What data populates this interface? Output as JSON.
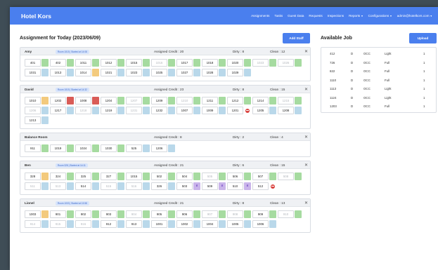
{
  "navbar": {
    "brand": "Hotel Kors",
    "links": [
      "Assignments",
      "Tasks",
      "Guest Data",
      "Requests",
      "Inspections"
    ],
    "reports": "Reports",
    "configurations": "Configurations",
    "user": "admin@hotelkors.com"
  },
  "assignment": {
    "title": "Assignment for Today (2023/06/09)",
    "add_staff_label": "Add Staff",
    "staff": [
      {
        "name": "Amy",
        "badge": "Room 1015 | Started at 14:08",
        "credit": "Assigned Credit : 20",
        "dirty": "Dirty : 8",
        "clean": "Clean : 12",
        "rooms": [
          [
            "401",
            "green",
            ""
          ],
          [
            "402",
            "green",
            ""
          ],
          [
            "1011",
            "green",
            ""
          ],
          [
            "1012",
            "green",
            ""
          ],
          [
            "1015",
            "green",
            ""
          ],
          [
            "1016",
            "green",
            "m"
          ],
          [
            "1017",
            "green",
            ""
          ],
          [
            "1018",
            "green",
            ""
          ],
          [
            "1020",
            "green",
            ""
          ],
          [
            "1023",
            "green",
            "m"
          ],
          [
            "1026",
            "green",
            "m"
          ],
          [
            "1031",
            "blue",
            ""
          ],
          [
            "1013",
            "blue",
            ""
          ],
          [
            "1014",
            "orange",
            ""
          ],
          [
            "1021",
            "blue",
            ""
          ],
          [
            "1023",
            "blue",
            ""
          ],
          [
            "1025",
            "blue",
            ""
          ],
          [
            "1027",
            "blue",
            ""
          ],
          [
            "1028",
            "blue",
            ""
          ],
          [
            "1029",
            "blue",
            ""
          ]
        ]
      },
      {
        "name": "David",
        "badge": "Room 1015 | Started at 14:32",
        "credit": "Assigned Credit : 23",
        "dirty": "Dirty : 8",
        "clean": "Clean : 15",
        "rooms": [
          [
            "1010",
            "orange",
            ""
          ],
          [
            "1202",
            "red",
            ""
          ],
          [
            "1008",
            "red",
            ""
          ],
          [
            "1204",
            "green",
            ""
          ],
          [
            "1207",
            "green",
            "m"
          ],
          [
            "1209",
            "green",
            ""
          ],
          [
            "1210",
            "green",
            "m"
          ],
          [
            "1211",
            "green",
            ""
          ],
          [
            "1212",
            "green",
            ""
          ],
          [
            "1214",
            "green",
            ""
          ],
          [
            "1215",
            "green",
            "m"
          ],
          [
            "1206",
            "blue",
            "m"
          ],
          [
            "1217",
            "blue",
            ""
          ],
          [
            "1218",
            "blue",
            "m"
          ],
          [
            "1219",
            "blue",
            ""
          ],
          [
            "1231",
            "blue",
            "m"
          ],
          [
            "1232",
            "blue",
            ""
          ],
          [
            "1007",
            "blue",
            ""
          ],
          [
            "1009",
            "blue",
            ""
          ],
          [
            "1201",
            "stop",
            ""
          ],
          [
            "1205",
            "blue",
            ""
          ],
          [
            "1208",
            "blue",
            ""
          ],
          [
            "1213",
            "blue",
            ""
          ]
        ]
      },
      {
        "name": "Balance Room",
        "badge": "",
        "credit": "Assigned Credit : 8",
        "dirty": "Dirty : 2",
        "clean": "Clean : 4",
        "rooms": [
          [
            "911",
            "green",
            ""
          ],
          [
            "1019",
            "green",
            ""
          ],
          [
            "1024",
            "green",
            ""
          ],
          [
            "1030",
            "green",
            ""
          ],
          [
            "525",
            "blue",
            ""
          ],
          [
            "1206",
            "blue",
            ""
          ]
        ]
      },
      {
        "name": "Ben",
        "badge": "Room 328 | Started at 14:11",
        "credit": "Assigned Credit : 21",
        "dirty": "Dirty : 6",
        "clean": "Clean : 15",
        "rooms": [
          [
            "328",
            "orange",
            ""
          ],
          [
            "324",
            "green",
            ""
          ],
          [
            "325",
            "green",
            ""
          ],
          [
            "327",
            "green",
            ""
          ],
          [
            "1015",
            "green",
            ""
          ],
          [
            "502",
            "green",
            ""
          ],
          [
            "504",
            "green",
            ""
          ],
          [
            "505",
            "green",
            "m"
          ],
          [
            "506",
            "green",
            ""
          ],
          [
            "507",
            "green",
            ""
          ],
          [
            "508",
            "green",
            "m"
          ],
          [
            "511",
            "blue",
            "m"
          ],
          [
            "513",
            "blue",
            "m"
          ],
          [
            "514",
            "blue",
            ""
          ],
          [
            "515",
            "blue",
            "m"
          ],
          [
            "516",
            "blue",
            "m"
          ],
          [
            "326",
            "blue",
            ""
          ],
          [
            "503",
            "purple",
            ""
          ],
          [
            "509",
            "purple",
            ""
          ],
          [
            "510",
            "purple",
            ""
          ],
          [
            "512",
            "stop",
            ""
          ]
        ]
      },
      {
        "name": "Lionel",
        "badge": "Room 1003 | Started at 13:58",
        "credit": "Assigned Credit : 21",
        "dirty": "Dirty : 8",
        "clean": "Clean : 13",
        "rooms": [
          [
            "1003",
            "orange",
            ""
          ],
          [
            "901",
            "green",
            ""
          ],
          [
            "902",
            "green",
            ""
          ],
          [
            "903",
            "green",
            ""
          ],
          [
            "904",
            "green",
            "m"
          ],
          [
            "905",
            "green",
            ""
          ],
          [
            "906",
            "green",
            ""
          ],
          [
            "907",
            "green",
            "m"
          ],
          [
            "908",
            "green",
            "m"
          ],
          [
            "909",
            "green",
            ""
          ],
          [
            "910",
            "green",
            "m"
          ],
          [
            "914",
            "blue",
            "m"
          ],
          [
            "915",
            "blue",
            "m"
          ],
          [
            "916",
            "blue",
            "m"
          ],
          [
            "912",
            "blue",
            ""
          ],
          [
            "913",
            "blue",
            ""
          ],
          [
            "1001",
            "blue",
            ""
          ],
          [
            "1002",
            "blue",
            ""
          ],
          [
            "1004",
            "blue",
            ""
          ],
          [
            "1005",
            "blue",
            ""
          ],
          [
            "1006",
            "blue",
            ""
          ]
        ]
      }
    ]
  },
  "jobs": {
    "title": "Available Job",
    "upload_label": "Upload",
    "rows": [
      [
        "412",
        "D",
        "OCC",
        "Light",
        "1"
      ],
      [
        "726",
        "D",
        "OCC",
        "Full",
        "1"
      ],
      [
        "822",
        "D",
        "OCC",
        "Full",
        "1"
      ],
      [
        "1110",
        "D",
        "OCC",
        "Full",
        "1"
      ],
      [
        "1113",
        "D",
        "OCC",
        "Light",
        "1"
      ],
      [
        "1124",
        "D",
        "OCC",
        "Light",
        "1"
      ],
      [
        "1203",
        "D",
        "OCC",
        "Full",
        "1"
      ]
    ]
  },
  "icons": {
    "close": "close-icon",
    "dropdown": "caret-down-icon",
    "rush": "priority-mark-icon",
    "blocked": "blocked-icon"
  },
  "colors": {
    "brand": "#4a7fee",
    "clean": "#a6dba0",
    "dirty": "#b9d8ea",
    "in_progress": "#f3ca7d",
    "occupied": "#d95c57",
    "priority": "#c9b4ea",
    "blocked": "#d9433f"
  }
}
